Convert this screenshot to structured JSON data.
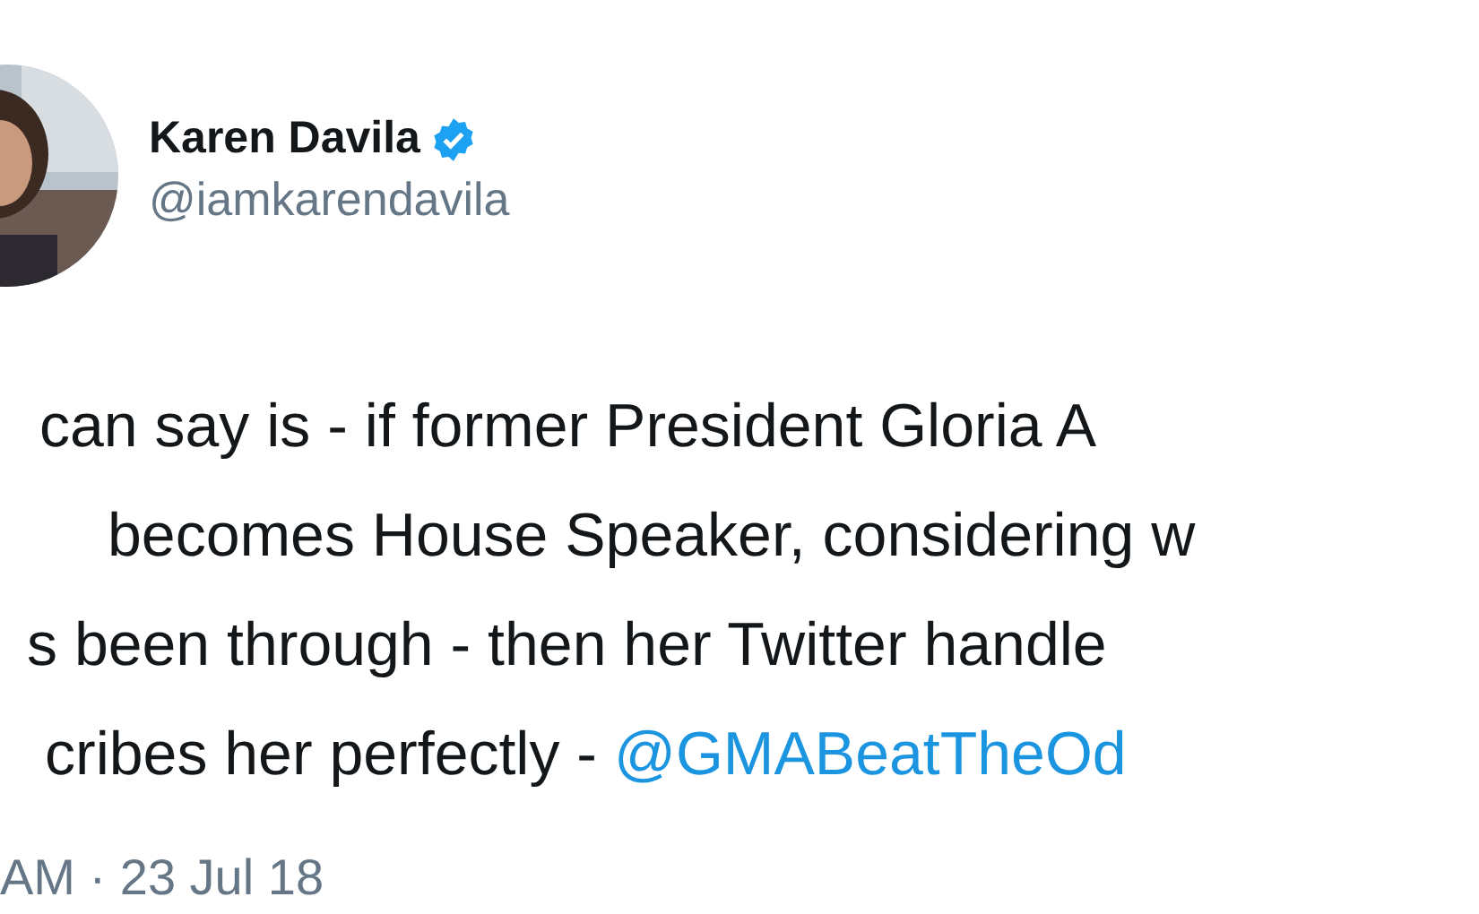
{
  "author": {
    "name": "Karen Davila",
    "verified": true,
    "handle": "@iamkarendavila"
  },
  "tweet": {
    "lines": [
      {
        "text": "can say is - if former President Gloria A"
      },
      {
        "text": "becomes House Speaker, considering w"
      },
      {
        "text": "s been through - then her Twitter handle"
      },
      {
        "text": "cribes her perfectly - ",
        "link": "@GMABeatTheOd"
      }
    ]
  },
  "timestamp": "AM · 23 Jul 18"
}
